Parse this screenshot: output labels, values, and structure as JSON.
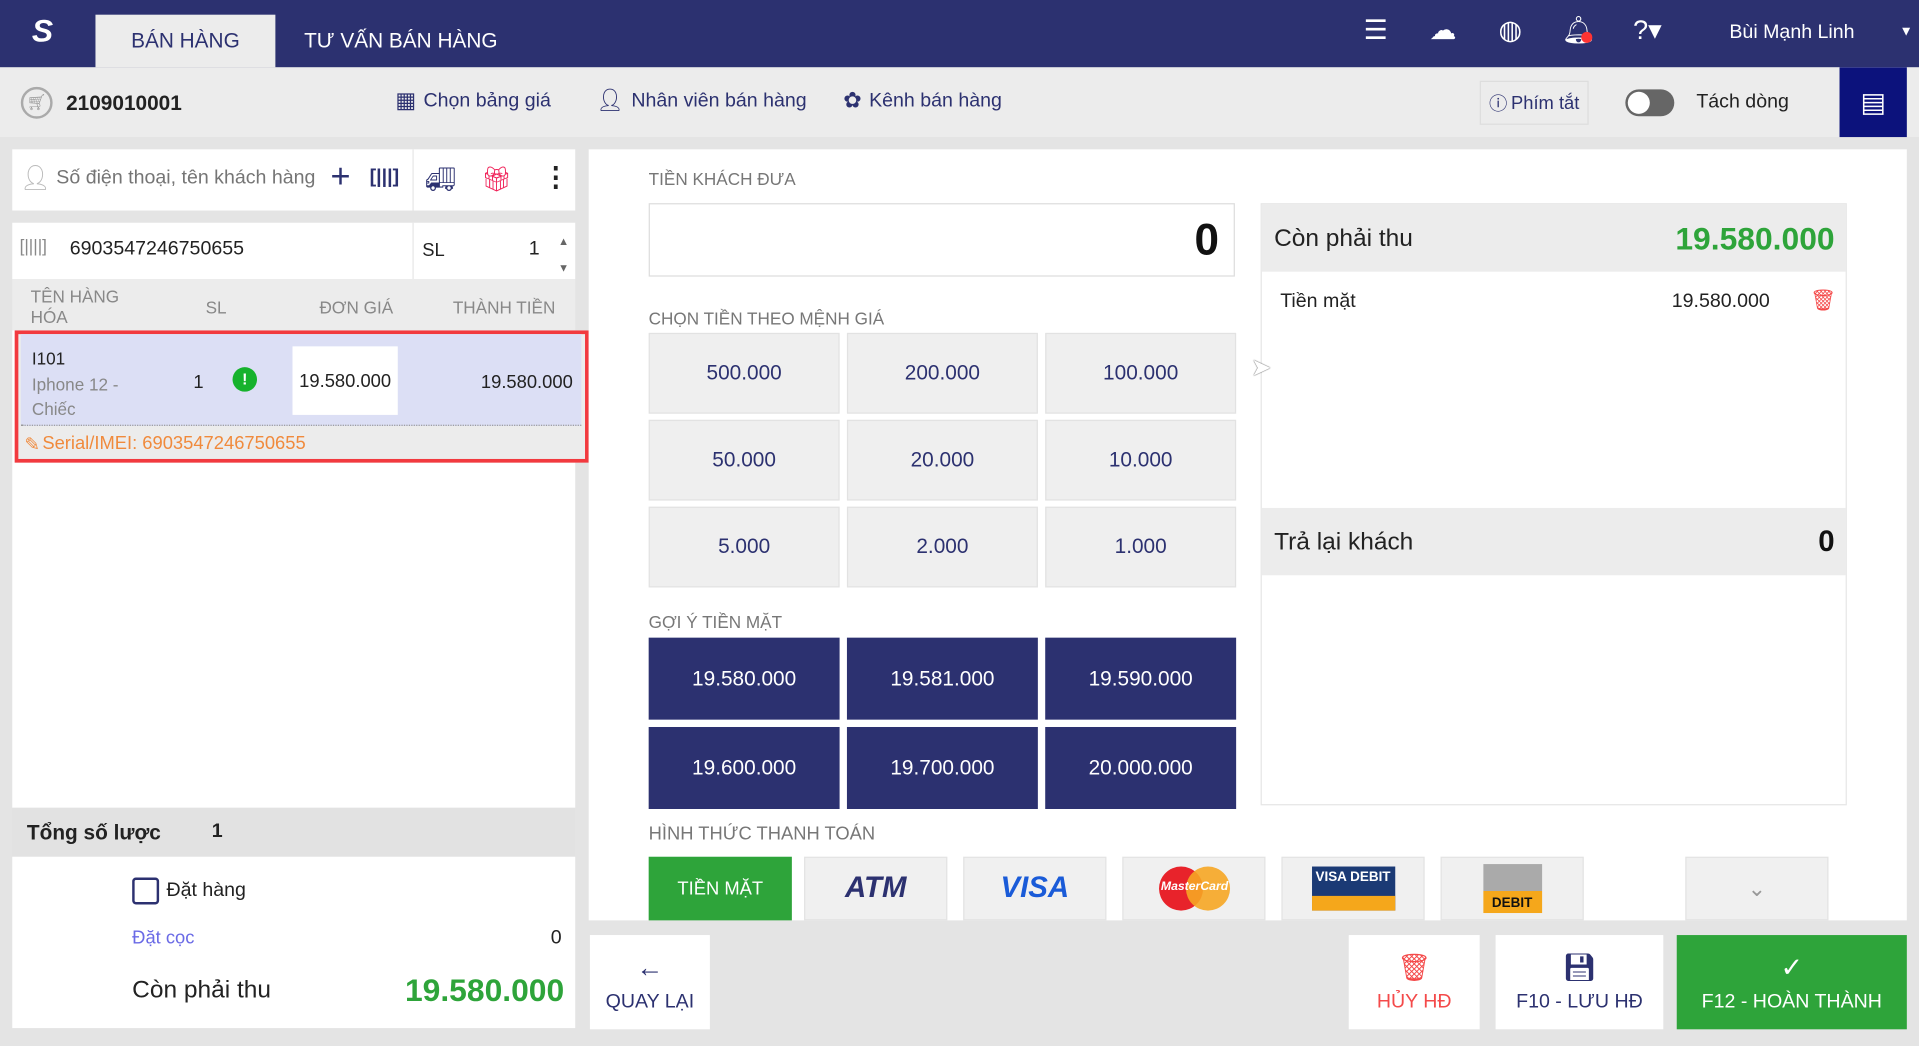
{
  "header": {
    "tabs": [
      {
        "label": "BÁN HÀNG",
        "active": true
      },
      {
        "label": "TƯ VẤN BÁN HÀNG",
        "active": false
      }
    ],
    "user": "Bùi Mạnh Linh"
  },
  "toolbar": {
    "invoice_id": "2109010001",
    "price_list": "Chọn bảng giá",
    "staff": "Nhân viên bán hàng",
    "channel": "Kênh bán hàng",
    "shortcuts": "Phím tắt",
    "split_lines": "Tách dòng"
  },
  "customer": {
    "placeholder": "Số điện thoại, tên khách hàng"
  },
  "scan": {
    "barcode": "6903547246750655",
    "qty_label": "SL",
    "qty": "1"
  },
  "table": {
    "headers": [
      "TÊN HÀNG HÓA",
      "SL",
      "ĐƠN GIÁ",
      "THÀNH TIỀN"
    ],
    "rows": [
      {
        "code": "I101",
        "name": "Iphone 12 - Chiếc",
        "qty": "1",
        "price": "19.580.000",
        "total": "19.580.000",
        "serial": "Serial/IMEI: 6903547246750655"
      }
    ]
  },
  "summary": {
    "total_qty_label": "Tổng số lược",
    "total_qty": "1",
    "order_label": "Đặt hàng",
    "deposit_label": "Đặt cọc",
    "deposit": "0",
    "due_label": "Còn phải thu",
    "due": "19.580.000"
  },
  "payment": {
    "given_label": "TIỀN KHÁCH ĐƯA",
    "given": "0",
    "denom_label": "CHỌN TIỀN THEO MỆNH GIÁ",
    "denominations": [
      "500.000",
      "200.000",
      "100.000",
      "50.000",
      "20.000",
      "10.000",
      "5.000",
      "2.000",
      "1.000"
    ],
    "suggest_label": "GỢI Ý TIỀN MẶT",
    "suggestions": [
      "19.580.000",
      "19.581.000",
      "19.590.000",
      "19.600.000",
      "19.700.000",
      "20.000.000"
    ],
    "method_label": "HÌNH THỨC THANH TOÁN",
    "methods": [
      "TIỀN MẶT",
      "ATM",
      "VISA",
      "MasterCard",
      "VISA DEBIT",
      "DEBIT"
    ]
  },
  "right": {
    "due_label": "Còn phải thu",
    "due": "19.580.000",
    "line_label": "Tiền mặt",
    "line_amount": "19.580.000",
    "change_label": "Trả lại khách",
    "change": "0"
  },
  "actions": {
    "back": "QUAY LẠI",
    "cancel": "HỦY HĐ",
    "save": "F10 - LƯU HĐ",
    "finish": "F12 - HOÀN THÀNH"
  },
  "colors": {
    "navy": "#2c3170",
    "green": "#2ea43a",
    "red": "#f44a4a",
    "orange": "#f08a3c"
  }
}
